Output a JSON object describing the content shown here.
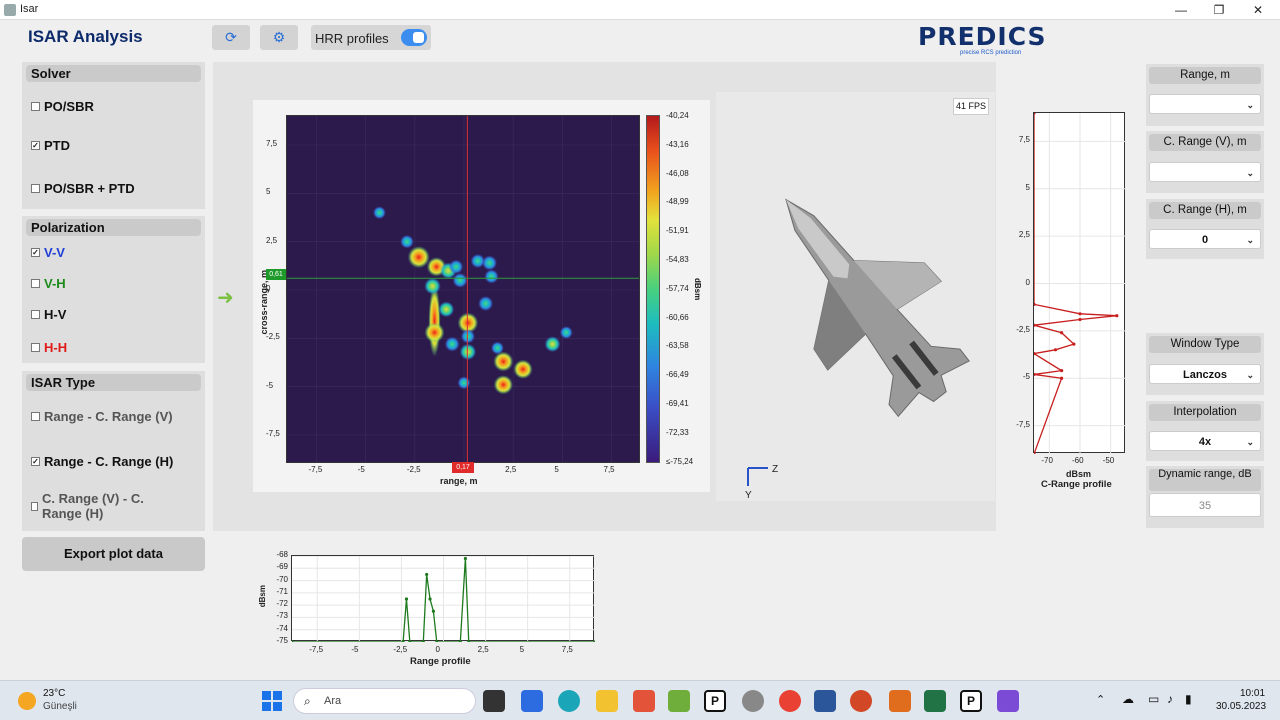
{
  "window": {
    "title": "Isar",
    "minimize": "—",
    "maximize": "❐",
    "close": "✕"
  },
  "header": {
    "app_title": "ISAR Analysis",
    "hrr_label": "HRR  profiles",
    "logo_text": "PREDICS",
    "logo_sub": "precise RCS prediction"
  },
  "solver": {
    "title": "Solver",
    "options": [
      {
        "label": "PO/SBR",
        "checked": false
      },
      {
        "label": "PTD",
        "checked": true
      },
      {
        "label": "PO/SBR + PTD",
        "checked": false
      }
    ]
  },
  "polarization": {
    "title": "Polarization",
    "options": [
      {
        "label": "V-V",
        "checked": true,
        "color": "#1f3fd6"
      },
      {
        "label": "V-H",
        "checked": false,
        "color": "#1b8a1b"
      },
      {
        "label": "H-V",
        "checked": false,
        "color": "#111111"
      },
      {
        "label": "H-H",
        "checked": false,
        "color": "#e01919"
      }
    ]
  },
  "isar_type": {
    "title": "ISAR Type",
    "options": [
      {
        "label": "Range - C. Range (V)",
        "checked": false
      },
      {
        "label": "Range - C. Range (H)",
        "checked": true
      },
      {
        "label": "C. Range (V) - C. Range (H)",
        "checked": false
      }
    ]
  },
  "export_label": "Export plot data",
  "isar_plot": {
    "xlabel": "range, m",
    "ylabel": "cross-range, m",
    "xticks": [
      "-7,5",
      "-5",
      "-2,5",
      "0",
      "2,5",
      "5",
      "7,5"
    ],
    "yticks": [
      "7,5",
      "5",
      "2,5",
      "0",
      "-2,5",
      "-5",
      "-7,5"
    ],
    "cursor_x_label": "0,17",
    "cursor_y_label": "0,61",
    "colorbar_unit": "dBsm",
    "colorbar_ticks": [
      "-40,24",
      "-43,16",
      "-46,08",
      "-48,99",
      "-51,91",
      "-54,83",
      "-57,74",
      "-60,66",
      "-63,58",
      "-66,49",
      "-69,41",
      "-72,33",
      "≤-75,24"
    ]
  },
  "view3d": {
    "fps": "41 FPS",
    "axis_z": "Z",
    "axis_y": "Y"
  },
  "crange_plot": {
    "title": "C-Range profile",
    "unit": "dBsm",
    "xticks": [
      "-70",
      "-60",
      "-50"
    ],
    "yticks": [
      "7,5",
      "5",
      "2,5",
      "0",
      "-2,5",
      "-5",
      "-7,5"
    ]
  },
  "range_plot": {
    "title": "Range profile",
    "unit": "dBsm",
    "xticks": [
      "-7,5",
      "-5",
      "-2,5",
      "0",
      "2,5",
      "5",
      "7,5"
    ],
    "yticks": [
      "-68",
      "-69",
      "-70",
      "-71",
      "-72",
      "-73",
      "-74",
      "-75"
    ]
  },
  "controls": {
    "range": {
      "label": "Range, m",
      "value": ""
    },
    "crange_v": {
      "label": "C. Range (V),  m",
      "value": ""
    },
    "crange_h": {
      "label": "C. Range (H),  m",
      "value": "0"
    },
    "window_type": {
      "label": "Window Type",
      "value": "Lanczos"
    },
    "interpolation": {
      "label": "Interpolation",
      "value": "4x"
    },
    "dynamic_range": {
      "label": "Dynamic range, dB",
      "value": "35"
    }
  },
  "taskbar": {
    "temp": "23°C",
    "weather": "Güneşli",
    "search": "Ara",
    "time": "10:01",
    "date": "30.05.2023"
  },
  "chart_data": [
    {
      "type": "heatmap",
      "title": "",
      "xlabel": "range, m",
      "ylabel": "cross-range, m",
      "xlim": [
        -9,
        9
      ],
      "ylim": [
        -9,
        9
      ],
      "colorbar_range": [
        -75.24,
        -40.24
      ],
      "colorbar_unit": "dBsm",
      "scatterers": [
        {
          "x": -4.3,
          "y": 4.0,
          "level": 0.35
        },
        {
          "x": -2.9,
          "y": 2.5,
          "level": 0.4
        },
        {
          "x": -2.3,
          "y": 1.7,
          "level": 1.0
        },
        {
          "x": -1.4,
          "y": 1.2,
          "level": 0.8
        },
        {
          "x": -0.8,
          "y": 1.0,
          "level": 0.6
        },
        {
          "x": -0.4,
          "y": 1.2,
          "level": 0.45
        },
        {
          "x": 0.7,
          "y": 1.5,
          "level": 0.45
        },
        {
          "x": 1.3,
          "y": 1.4,
          "level": 0.5
        },
        {
          "x": 1.4,
          "y": 0.7,
          "level": 0.45
        },
        {
          "x": -1.6,
          "y": 0.2,
          "level": 0.6
        },
        {
          "x": -0.2,
          "y": 0.5,
          "level": 0.5
        },
        {
          "x": -1.5,
          "y": -2.2,
          "level": 0.85
        },
        {
          "x": -0.9,
          "y": -1.0,
          "level": 0.55
        },
        {
          "x": 0.2,
          "y": -1.7,
          "level": 0.9
        },
        {
          "x": 0.2,
          "y": -2.4,
          "level": 0.45
        },
        {
          "x": 1.1,
          "y": -0.7,
          "level": 0.5
        },
        {
          "x": -0.6,
          "y": -2.8,
          "level": 0.5
        },
        {
          "x": 0.2,
          "y": -3.2,
          "level": 0.6
        },
        {
          "x": 1.7,
          "y": -3.0,
          "level": 0.35
        },
        {
          "x": 2.0,
          "y": -3.7,
          "level": 0.85
        },
        {
          "x": 3.0,
          "y": -4.1,
          "level": 0.8
        },
        {
          "x": 4.5,
          "y": -2.8,
          "level": 0.55
        },
        {
          "x": 5.2,
          "y": -2.2,
          "level": 0.35
        },
        {
          "x": 2.0,
          "y": -4.9,
          "level": 0.8
        },
        {
          "x": 0.0,
          "y": -4.8,
          "level": 0.35
        }
      ]
    },
    {
      "type": "line",
      "title": "C-Range profile",
      "xlabel": "dBsm",
      "xlim": [
        -75,
        -45
      ],
      "ylim": [
        -9,
        9
      ],
      "series": [
        {
          "x": [
            -75,
            -75,
            -60,
            -48,
            -60,
            -75,
            -66,
            -62,
            -68,
            -75,
            -66,
            -75,
            -66,
            -75
          ],
          "y": [
            9,
            -1.1,
            -1.6,
            -1.7,
            -1.9,
            -2.2,
            -2.6,
            -3.2,
            -3.5,
            -3.7,
            -4.6,
            -4.8,
            -5.0,
            -9
          ]
        }
      ]
    },
    {
      "type": "line",
      "title": "Range profile",
      "ylabel": "dBsm",
      "xlim": [
        -9,
        9
      ],
      "ylim": [
        -75,
        -68
      ],
      "series": [
        {
          "x": [
            -9,
            -2.4,
            -2.2,
            -2.0,
            -1.2,
            -1.0,
            -0.8,
            -0.6,
            -0.4,
            1.0,
            1.3,
            1.5,
            9
          ],
          "y": [
            -75,
            -75,
            -71.5,
            -75,
            -75,
            -69.5,
            -71.5,
            -72.5,
            -75,
            -75,
            -68.2,
            -75,
            -75
          ]
        }
      ]
    }
  ]
}
